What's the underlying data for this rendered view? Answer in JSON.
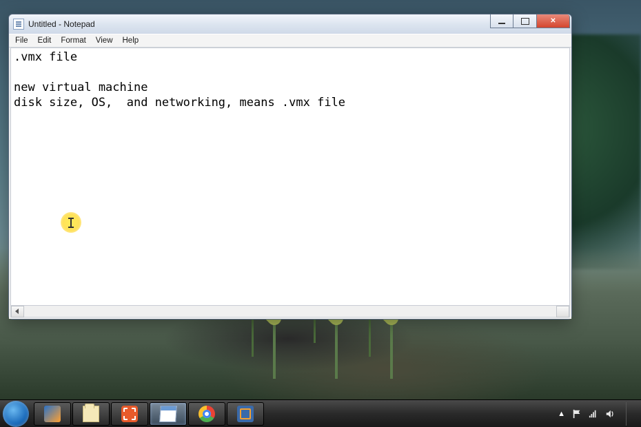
{
  "window": {
    "title": "Untitled - Notepad",
    "menu": [
      "File",
      "Edit",
      "Format",
      "View",
      "Help"
    ],
    "content": ".vmx file\n\nnew virtual machine\ndisk size, OS,  and networking, means .vmx file"
  },
  "taskbar": {
    "items": [
      {
        "name": "outlook",
        "active": false
      },
      {
        "name": "explorer",
        "active": false
      },
      {
        "name": "snipping-tool",
        "active": false
      },
      {
        "name": "notepad",
        "active": true
      },
      {
        "name": "chrome",
        "active": false
      },
      {
        "name": "vmware",
        "active": false
      }
    ],
    "tray": {
      "show_hidden": "▲",
      "flag_icon": "flag",
      "network_icon": "signal",
      "volume_icon": "volume",
      "clock_shown": false
    }
  }
}
